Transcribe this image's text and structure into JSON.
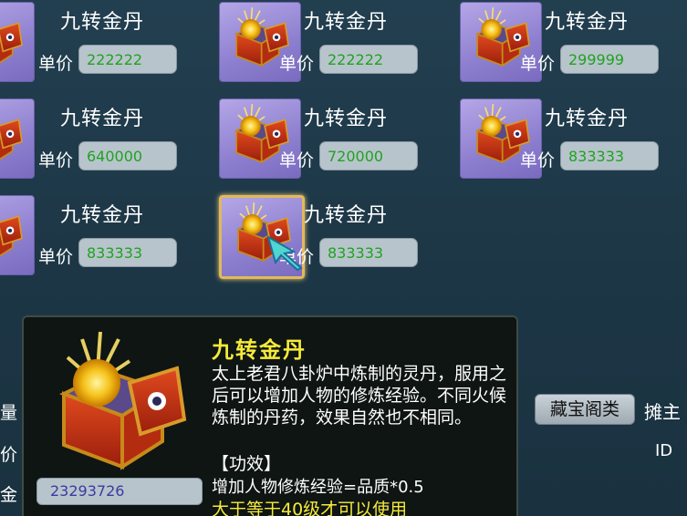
{
  "items": [
    {
      "name": "九转金丹",
      "price_label": "单价",
      "price": "222222",
      "selected": false
    },
    {
      "name": "九转金丹",
      "price_label": "单价",
      "price": "222222",
      "selected": false
    },
    {
      "name": "九转金丹",
      "price_label": "单价",
      "price": "299999",
      "selected": false
    },
    {
      "name": "九转金丹",
      "price_label": "单价",
      "price": "640000",
      "selected": false
    },
    {
      "name": "九转金丹",
      "price_label": "单价",
      "price": "720000",
      "selected": false
    },
    {
      "name": "九转金丹",
      "price_label": "单价",
      "price": "833333",
      "selected": false
    },
    {
      "name": "九转金丹",
      "price_label": "单价",
      "price": "833333",
      "selected": false
    },
    {
      "name": "九转金丹",
      "price_label": "单价",
      "price": "833333",
      "selected": true
    }
  ],
  "background_panel": {
    "category_button": "藏宝阁类",
    "seller_label": "摊主",
    "id_label": "ID",
    "left_labels": [
      "量",
      "价",
      "金"
    ],
    "money_value": "23293726"
  },
  "tooltip": {
    "title": "九转金丹",
    "description": "太上老君八卦炉中炼制的灵丹，服用之后可以增加人物的修炼经验。不同火候炼制的丹药，效果自然也不相同。",
    "effect_header": "【功效】",
    "effect_formula": "增加人物修炼经验=品质*0.5",
    "requirement": "大于等于40级才可以使用"
  },
  "colors": {
    "title_yellow": "#f6ea3a",
    "price_green": "#1fa31f",
    "selected_border": "#e3b85a"
  }
}
